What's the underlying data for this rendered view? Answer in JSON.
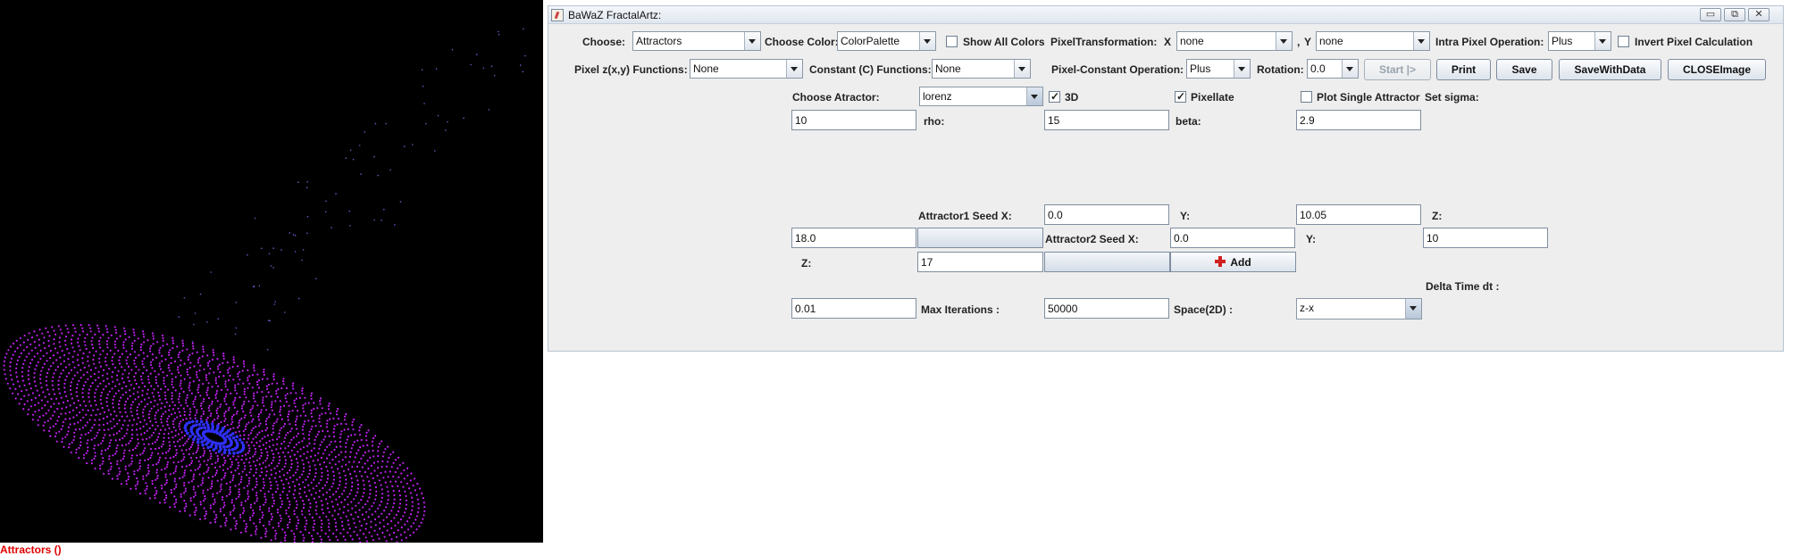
{
  "render": {
    "caption": "Attractors ()",
    "colors": {
      "background": "#000000",
      "spiral": "#c020f0",
      "core": "#3030ff",
      "dots": "#6a5acd"
    }
  },
  "window": {
    "title": "BaWaZ FractalArtz:",
    "controls": {
      "minimize": "▭",
      "maximize": "⧉",
      "close": "✕"
    }
  },
  "row1": {
    "choose_label": "Choose:",
    "choose_value": "Attractors",
    "choose_color_label": "Choose Color:",
    "choose_color_value": "ColorPalette",
    "show_all_colors": "Show All Colors",
    "pixel_transformation_label": "PixelTransformation:",
    "x_label": "X",
    "x_value": "none",
    "comma": ",",
    "y_label": "Y",
    "y_value": "none",
    "intra_pixel_label": "Intra Pixel Operation:",
    "intra_pixel_value": "Plus",
    "invert_pixel": "Invert Pixel Calculation"
  },
  "row2": {
    "pixel_functions_label": "Pixel z(x,y) Functions:",
    "pixel_functions_value": "None",
    "constant_functions_label": "Constant (C) Functions:",
    "constant_functions_value": "None",
    "pixel_constant_label": "Pixel-Constant Operation:",
    "pixel_constant_value": "Plus",
    "rotation_label": "Rotation:",
    "rotation_value": "0.0",
    "start_button": "Start |>",
    "print_button": "Print",
    "save_button": "Save",
    "save_with_data_button": "SaveWithData",
    "close_image_button": "CLOSEImage"
  },
  "attractor": {
    "choose_label": "Choose Atractor:",
    "attractor_value": "lorenz",
    "three_d": "3D",
    "pixellate": "Pixellate",
    "plot_single": "Plot Single Attractor",
    "set_sigma_label": "Set sigma:",
    "sigma_value": "10",
    "rho_label": "rho:",
    "rho_value": "15",
    "beta_label": "beta:",
    "beta_value": "2.9"
  },
  "seeds": {
    "attractor1_label": "Attractor1  Seed  X:",
    "a1_x": "0.0",
    "y_label": "Y:",
    "a1_y": "10.05",
    "z_label": "Z:",
    "a1_z": "18.0",
    "attractor2_label": "Attractor2  Seed  X:",
    "a2_x": "0.0",
    "a2_y": "10",
    "z2_label": "Z:",
    "a2_z": "17",
    "add_button": "Add",
    "delta_time_label": "Delta Time dt :",
    "delta_time_value": "0.01",
    "max_iterations_label": "Max Iterations  :",
    "max_iterations_value": "50000",
    "space_label": "Space(2D)  :",
    "space_value": "z-x"
  }
}
